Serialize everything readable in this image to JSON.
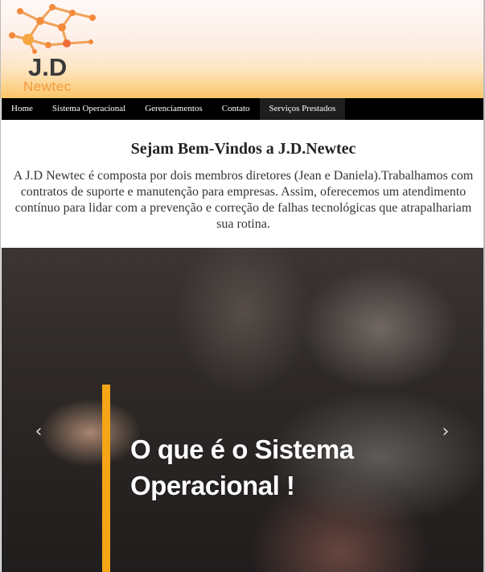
{
  "logo": {
    "title": "J.D",
    "subtitle": "Newtec",
    "icon": "network-molecule-icon"
  },
  "nav": {
    "items": [
      "Home",
      "Sistema Operacional",
      "Gerenciamentos",
      "Contato",
      "Serviços Prestados"
    ]
  },
  "welcome": {
    "heading": "Sejam Bem-Vindos a J.D.Newtec",
    "body": "A J.D Newtec é composta por dois membros diretores (Jean e Daniela).Trabalhamos com contratos de suporte e manutenção para empresas. Assim, oferecemos um atendimento contínuo para lidar com a prevenção e correção de falhas tecnológicas que atrapalhariam sua rotina."
  },
  "carousel": {
    "slide_line1": "O que é o Sistema",
    "slide_line2": "Operacional !",
    "prev_icon": "‹",
    "next_icon": "›",
    "accent": "#f5a516"
  },
  "colors": {
    "nav_bg": "#000000",
    "logo_orange": "#f19a3a"
  }
}
